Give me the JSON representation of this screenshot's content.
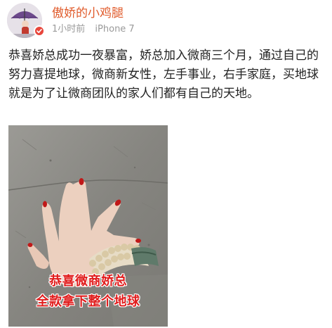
{
  "post": {
    "username": "傲娇的小鸡腿",
    "time": "1小时前",
    "device": "iPhone 7",
    "text": "恭喜娇总成功一夜暴富，娇总加入微商三个月，通过自己的努力喜提地球，微商新女性，左手事业，右手家庭，买地球就是为了让微商团队的家人们都有自己的天地。",
    "photo": {
      "caption_line1": "恭喜微商娇总",
      "caption_line2": "全款拿下整个地球"
    }
  },
  "colors": {
    "username": "#e05a2a",
    "meta": "#9a9a9a",
    "caption": "#e11c1c",
    "badge": "#e8463c"
  },
  "icons": {
    "avatar": "umbrella-avatar",
    "badge": "verified-badge-icon"
  }
}
